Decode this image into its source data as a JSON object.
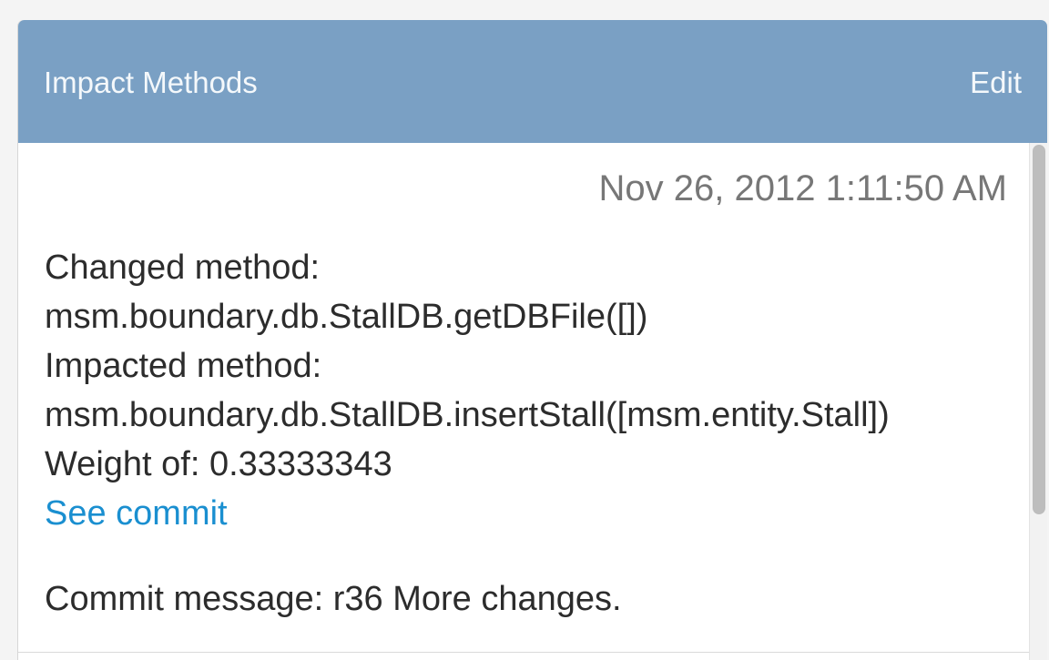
{
  "panel": {
    "title": "Impact Methods",
    "edit_label": "Edit"
  },
  "entry": {
    "timestamp": "Nov 26, 2012 1:11:50 AM",
    "changed_label": "Changed method:",
    "changed_method": "msm.boundary.db.StallDB.getDBFile([])",
    "impacted_label": "Impacted method:",
    "impacted_method": "msm.boundary.db.StallDB.insertStall([msm.entity.Stall])",
    "weight": "Weight of: 0.33333343",
    "see_commit_label": "See commit",
    "commit_message": "Commit message: r36 More changes."
  },
  "colors": {
    "header": "#7aa0c4",
    "link": "#1a8fd0",
    "timestamp": "#777777"
  }
}
